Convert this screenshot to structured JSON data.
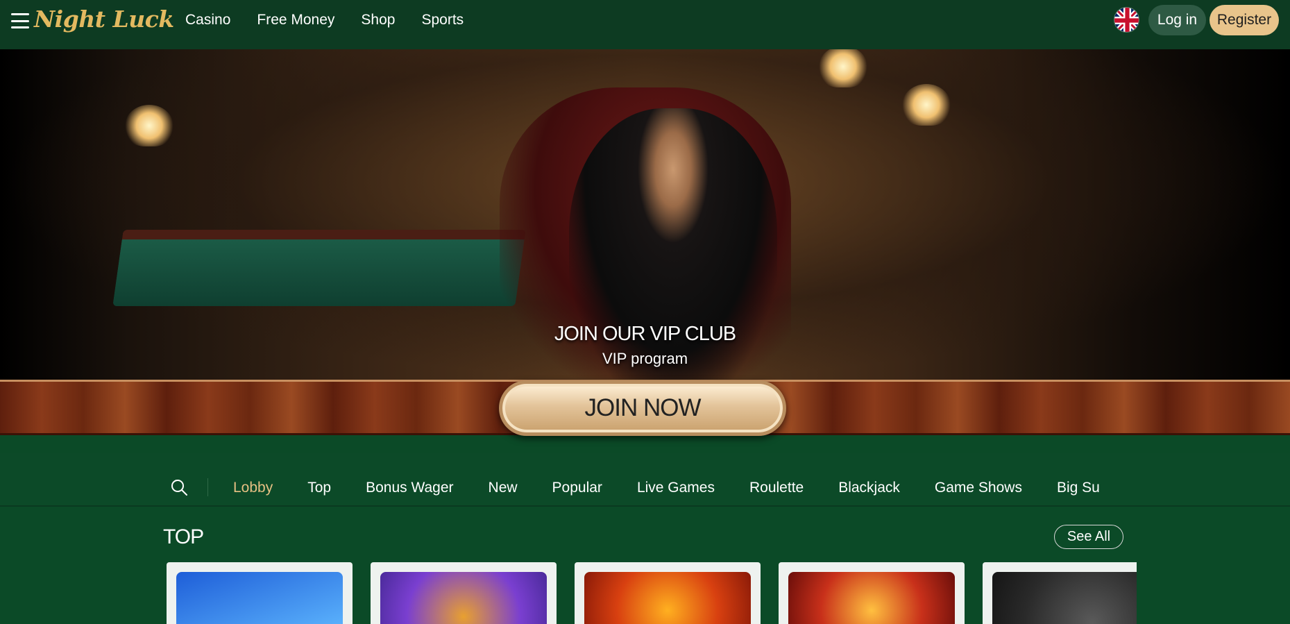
{
  "header": {
    "logo": "Night Luck",
    "nav": [
      "Casino",
      "Free Money",
      "Shop",
      "Sports"
    ],
    "login_label": "Log in",
    "register_label": "Register",
    "language_icon": "uk-flag-icon"
  },
  "hero": {
    "title": "JOIN OUR VIP CLUB",
    "subtitle": "VIP program",
    "cta_label": "JOIN NOW"
  },
  "categories": {
    "search_icon": "search-icon",
    "tabs": [
      "Lobby",
      "Top",
      "Bonus Wager",
      "New",
      "Popular",
      "Live Games",
      "Roulette",
      "Blackjack",
      "Game Shows",
      "Big Su"
    ],
    "active": "Lobby"
  },
  "top_section": {
    "title": "TOP",
    "see_all_label": "See All"
  },
  "colors": {
    "brand_gold": "#e3b960",
    "register_bg": "#e8c48b",
    "header_bg": "#0d3b22",
    "page_bg": "#0b4a27",
    "active_tab": "#e6c083"
  }
}
